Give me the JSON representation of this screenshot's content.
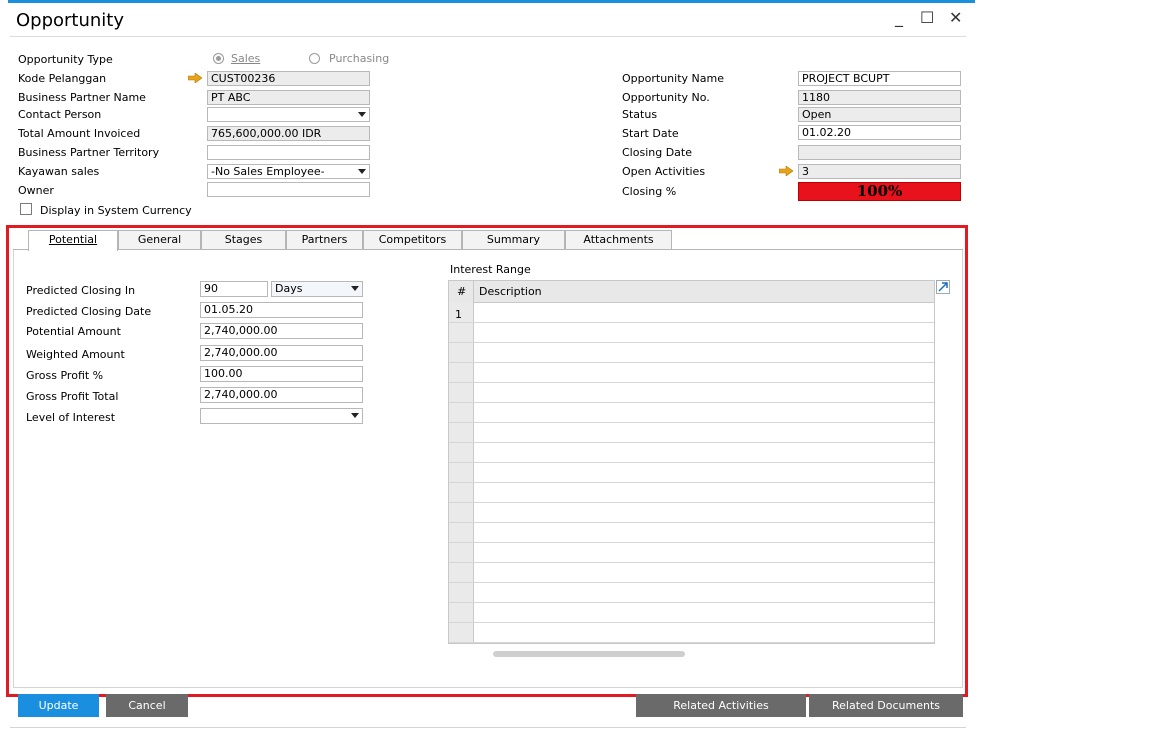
{
  "window": {
    "title": "Opportunity",
    "controls": {
      "minimize": "_",
      "maximize": "☐",
      "close": "✕"
    }
  },
  "header_left": {
    "opportunity_type_label": "Opportunity Type",
    "radio_sales": "Sales",
    "radio_purchasing": "Purchasing",
    "kode_pelanggan_label": "Kode Pelanggan",
    "kode_pelanggan_value": "CUST00236",
    "bp_name_label": "Business Partner Name",
    "bp_name_value": "PT ABC",
    "contact_person_label": "Contact Person",
    "contact_person_value": "",
    "total_invoiced_label": "Total Amount Invoiced",
    "total_invoiced_value": "765,600,000.00 IDR",
    "territory_label": "Business Partner Territory",
    "territory_value": "",
    "kayawan_label": "Kayawan sales",
    "kayawan_value": "-No Sales Employee-",
    "owner_label": "Owner",
    "owner_value": "",
    "display_currency_label": "Display in System Currency"
  },
  "header_right": {
    "opp_name_label": "Opportunity Name",
    "opp_name_value": "PROJECT BCUPT",
    "opp_no_label": "Opportunity No.",
    "opp_no_value": "1180",
    "status_label": "Status",
    "status_value": "Open",
    "start_date_label": "Start Date",
    "start_date_value": "01.02.20",
    "closing_date_label": "Closing Date",
    "closing_date_value": "",
    "open_activities_label": "Open Activities",
    "open_activities_value": "3",
    "closing_pct_label": "Closing %",
    "closing_pct_value": "100%"
  },
  "tabs": [
    {
      "label": "Potential"
    },
    {
      "label": "General"
    },
    {
      "label": "Stages"
    },
    {
      "label": "Partners"
    },
    {
      "label": "Competitors"
    },
    {
      "label": "Summary"
    },
    {
      "label": "Attachments"
    }
  ],
  "potential": {
    "closing_in_label": "Predicted Closing In",
    "closing_in_value": "90",
    "closing_in_unit": "Days",
    "closing_date_label": "Predicted Closing Date",
    "closing_date_value": "01.05.20",
    "potential_amount_label": "Potential Amount",
    "potential_amount_value": "2,740,000.00",
    "weighted_amount_label": "Weighted Amount",
    "weighted_amount_value": "2,740,000.00",
    "gross_profit_pct_label": "Gross Profit %",
    "gross_profit_pct_value": "100.00",
    "gross_profit_total_label": "Gross Profit Total",
    "gross_profit_total_value": "2,740,000.00",
    "level_of_interest_label": "Level of Interest",
    "level_of_interest_value": ""
  },
  "interest_range": {
    "title": "Interest Range",
    "col_num": "#",
    "col_desc": "Description",
    "rows": [
      "1"
    ]
  },
  "buttons": {
    "update": "Update",
    "cancel": "Cancel",
    "related_activities": "Related Activities",
    "related_documents": "Related Documents"
  },
  "colors": {
    "accent": "#1b8fdf",
    "closing_bar": "#e8121c",
    "highlight_frame": "#e11b22"
  }
}
